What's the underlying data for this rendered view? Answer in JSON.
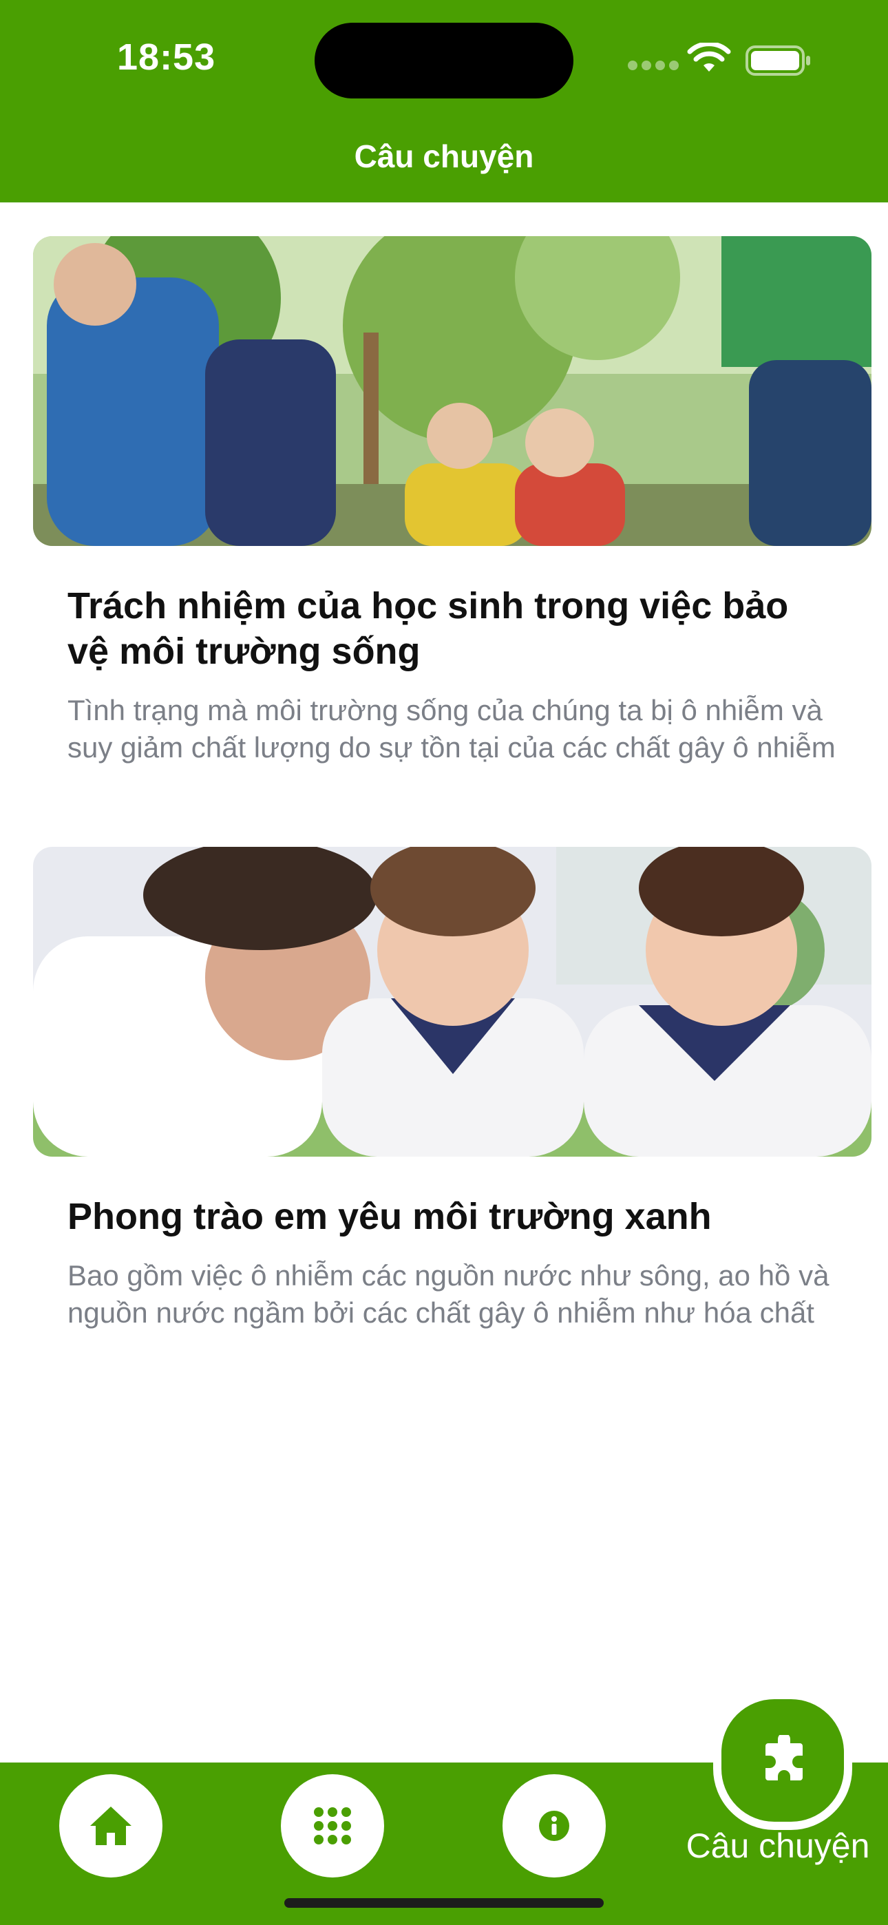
{
  "status_bar": {
    "time": "18:53"
  },
  "header": {
    "title": "Câu chuyện"
  },
  "stories": [
    {
      "title": "Trách nhiệm của học sinh trong việc bảo vệ môi trường sống",
      "excerpt": "Tình trạng mà môi trường sống của chúng ta bị ô nhiễm và suy giảm chất lượng do sự tồn tại của các chất gây ô nhiễm"
    },
    {
      "title": "Phong trào em yêu môi trường xanh",
      "excerpt": "Bao gồm việc ô nhiễm các nguồn nước như sông, ao hồ và nguồn nước ngầm bởi các chất gây ô nhiễm như hóa chất"
    }
  ],
  "tab_bar": {
    "tabs": [
      {
        "icon": "home-icon"
      },
      {
        "icon": "grid-icon"
      },
      {
        "icon": "info-icon"
      },
      {
        "icon": "puzzle-icon",
        "label": "Câu chuyện",
        "active": true
      }
    ]
  },
  "colors": {
    "primary": "#4a9f02",
    "title_text": "#111111",
    "excerpt_text": "#7b7f87"
  }
}
